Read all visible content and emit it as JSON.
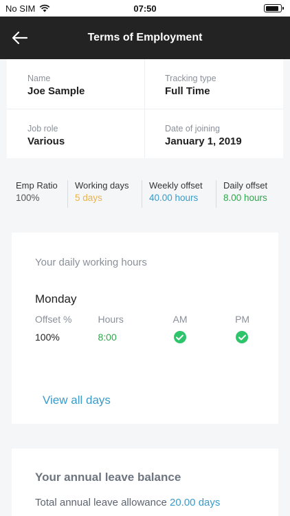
{
  "status_bar": {
    "carrier": "No SIM",
    "time": "07:50",
    "battery_level": 0.9
  },
  "nav": {
    "title": "Terms of Employment",
    "back_icon": "arrow-left-icon"
  },
  "employee": {
    "name_label": "Name",
    "name_value": "Joe Sample",
    "tracking_label": "Tracking type",
    "tracking_value": "Full Time",
    "role_label": "Job role",
    "role_value": "Various",
    "joining_label": "Date of joining",
    "joining_value": "January 1, 2019"
  },
  "stats": [
    {
      "label": "Emp Ratio",
      "value": "100%",
      "color": "#555555"
    },
    {
      "label": "Working days",
      "value": "5 days",
      "color": "#e9b44a"
    },
    {
      "label": "Weekly offset",
      "value": "40.00 hours",
      "color": "#3a9ac8"
    },
    {
      "label": "Daily offset",
      "value": "8.00 hours",
      "color": "#2ea54a"
    }
  ],
  "hours_card": {
    "heading": "Your daily working hours",
    "day": "Monday",
    "headers": {
      "offset": "Offset %",
      "hours": "Hours",
      "am": "AM",
      "pm": "PM"
    },
    "values": {
      "offset": "100%",
      "hours": "8:00"
    },
    "am_icon": "check-circle-icon",
    "pm_icon": "check-circle-icon",
    "view_all": "View all days"
  },
  "leave_card": {
    "heading": "Your annual leave balance",
    "allowance_label": "Total annual leave allowance",
    "allowance_value": "20.00",
    "allowance_unit": "days"
  }
}
